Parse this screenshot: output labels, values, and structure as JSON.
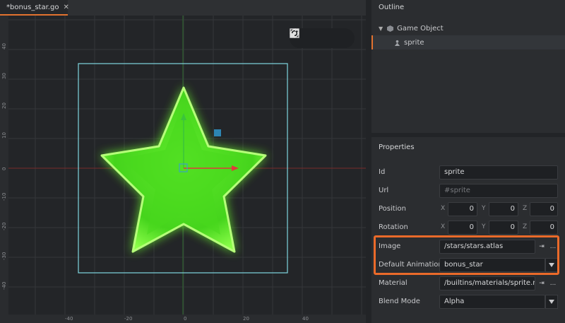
{
  "tab": {
    "title": "*bonus_star.go",
    "close": "✕"
  },
  "rulers": {
    "left": [
      "40",
      "30",
      "20",
      "10",
      "0",
      "-10",
      "-20",
      "-30",
      "-40"
    ],
    "bottom": [
      "-40",
      "-20",
      "0",
      "20",
      "40"
    ]
  },
  "toolbar": {
    "icons": [
      "move-icon",
      "rotate-icon",
      "scale-icon"
    ]
  },
  "outline": {
    "title": "Outline",
    "items": [
      {
        "label": "Game Object",
        "expanded": true
      },
      {
        "label": "sprite",
        "selected": true
      }
    ]
  },
  "properties": {
    "title": "Properties",
    "id": {
      "label": "Id",
      "value": "sprite"
    },
    "url": {
      "label": "Url",
      "placeholder": "#sprite"
    },
    "position": {
      "label": "Position",
      "x": "0",
      "y": "0",
      "z": "0"
    },
    "rotation": {
      "label": "Rotation",
      "x": "0",
      "y": "0",
      "z": "0"
    },
    "axes": {
      "x": "X",
      "y": "Y",
      "z": "Z"
    },
    "image": {
      "label": "Image",
      "value": "/stars/stars.atlas",
      "ellipsis": "..."
    },
    "default_animation": {
      "label": "Default Animation",
      "value": "bonus_star"
    },
    "material": {
      "label": "Material",
      "value": "/builtins/materials/sprite.mat",
      "ellipsis": "..."
    },
    "blend_mode": {
      "label": "Blend Mode",
      "value": "Alpha"
    }
  },
  "colors": {
    "accent": "#e2722f",
    "highlight": "#ea6a2a",
    "star": "#6dff2a",
    "selection_box": "#7fd6e0",
    "x_axis": "#e03a3a",
    "y_axis": "#3bc43b"
  }
}
